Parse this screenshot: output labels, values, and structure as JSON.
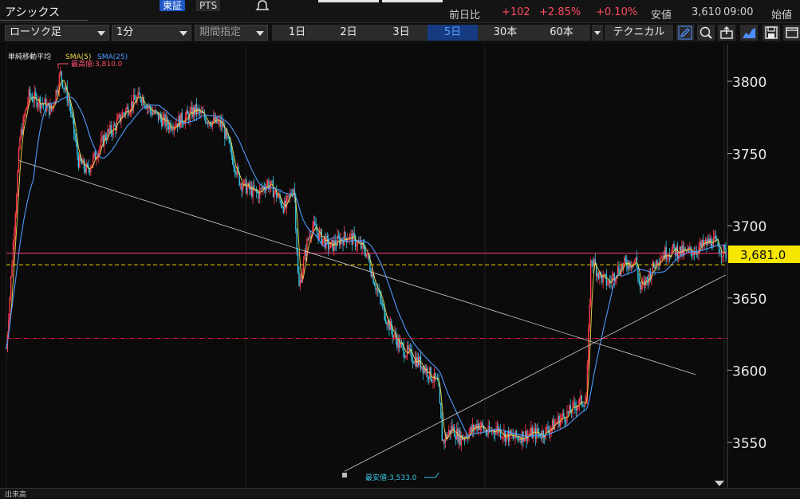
{
  "header": {
    "title": "アシックス",
    "market_tabs": [
      "東証",
      "PTS"
    ],
    "quote": {
      "prev_label": "前日比",
      "change": "+102",
      "change_pct": "+2.85%",
      "other_pct": "+0.10%",
      "low_label": "安値",
      "low_value": "3,610",
      "time": "09:00",
      "open_label": "始値"
    }
  },
  "toolbar": {
    "chart_type": "ローソク足",
    "interval": "1分",
    "period_select": "期間指定",
    "ranges": [
      "1日",
      "2日",
      "3日",
      "5日",
      "30本",
      "60本"
    ],
    "active_range": "5日",
    "technical_label": "テクニカル",
    "tools": [
      "pencil-icon",
      "zoom-icon",
      "export-icon",
      "area-chart-icon",
      "save-icon",
      "window-icon"
    ]
  },
  "chart": {
    "indicator_label": "単純移動平均",
    "sma5_label": "SMA(5)",
    "sma25_label": "SMA(25)",
    "high_label": "最高値:3,810.0",
    "low_label": "最安値:3,533.0",
    "current_price": "3,681.0",
    "y_ticks": [
      "3800",
      "3750",
      "3700",
      "3650",
      "3600",
      "3550"
    ],
    "bottom_label": "出来高",
    "colors": {
      "up": "#ff3b4e",
      "down": "#39c7e5",
      "sma5": "#f0d84a",
      "sma25": "#4d9bff",
      "pink_line": "#ff3d7a",
      "yellow_line": "#f0d000"
    }
  },
  "chart_data": {
    "type": "candlestick",
    "interval": "1分",
    "ylim": [
      3520,
      3830
    ],
    "high": 3810.0,
    "low": 3533.0,
    "current": 3681.0,
    "reference_lines": {
      "pink": 3681.0,
      "yellow_dashed": 3673.0,
      "red_dashdot": 3622.0
    },
    "price_path": [
      [
        0,
        3615
      ],
      [
        3,
        3760
      ],
      [
        5,
        3790
      ],
      [
        8,
        3785
      ],
      [
        10,
        3780
      ],
      [
        12,
        3805
      ],
      [
        14,
        3785
      ],
      [
        16,
        3745
      ],
      [
        18,
        3738
      ],
      [
        20,
        3750
      ],
      [
        22,
        3762
      ],
      [
        24,
        3768
      ],
      [
        26,
        3778
      ],
      [
        28,
        3785
      ],
      [
        30,
        3790
      ],
      [
        32,
        3780
      ],
      [
        34,
        3775
      ],
      [
        36,
        3770
      ],
      [
        38,
        3772
      ],
      [
        40,
        3775
      ],
      [
        42,
        3780
      ],
      [
        44,
        3775
      ],
      [
        46,
        3772
      ],
      [
        48,
        3770
      ],
      [
        50,
        3750
      ],
      [
        52,
        3730
      ],
      [
        54,
        3725
      ],
      [
        56,
        3722
      ],
      [
        58,
        3730
      ],
      [
        60,
        3722
      ],
      [
        62,
        3712
      ],
      [
        64,
        3728
      ],
      [
        65,
        3655
      ],
      [
        67,
        3690
      ],
      [
        68,
        3700
      ],
      [
        70,
        3692
      ],
      [
        72,
        3685
      ],
      [
        74,
        3690
      ],
      [
        76,
        3693
      ],
      [
        78,
        3688
      ],
      [
        80,
        3682
      ],
      [
        82,
        3660
      ],
      [
        84,
        3640
      ],
      [
        86,
        3625
      ],
      [
        88,
        3615
      ],
      [
        90,
        3610
      ],
      [
        92,
        3605
      ],
      [
        94,
        3598
      ],
      [
        96,
        3590
      ],
      [
        97,
        3550
      ],
      [
        99,
        3560
      ],
      [
        101,
        3553
      ],
      [
        103,
        3557
      ],
      [
        105,
        3563
      ],
      [
        107,
        3556
      ],
      [
        109,
        3560
      ],
      [
        111,
        3555
      ],
      [
        113,
        3553
      ],
      [
        115,
        3555
      ],
      [
        117,
        3556
      ],
      [
        119,
        3556
      ],
      [
        121,
        3560
      ],
      [
        123,
        3566
      ],
      [
        125,
        3570
      ],
      [
        127,
        3577
      ],
      [
        129,
        3580
      ],
      [
        130,
        3678
      ],
      [
        132,
        3665
      ],
      [
        134,
        3660
      ],
      [
        136,
        3670
      ],
      [
        138,
        3674
      ],
      [
        140,
        3676
      ],
      [
        141,
        3655
      ],
      [
        143,
        3666
      ],
      [
        145,
        3678
      ],
      [
        147,
        3682
      ],
      [
        149,
        3683
      ],
      [
        151,
        3681
      ],
      [
        153,
        3683
      ],
      [
        155,
        3686
      ],
      [
        157,
        3690
      ],
      [
        159,
        3683
      ],
      [
        160,
        3681
      ]
    ]
  }
}
